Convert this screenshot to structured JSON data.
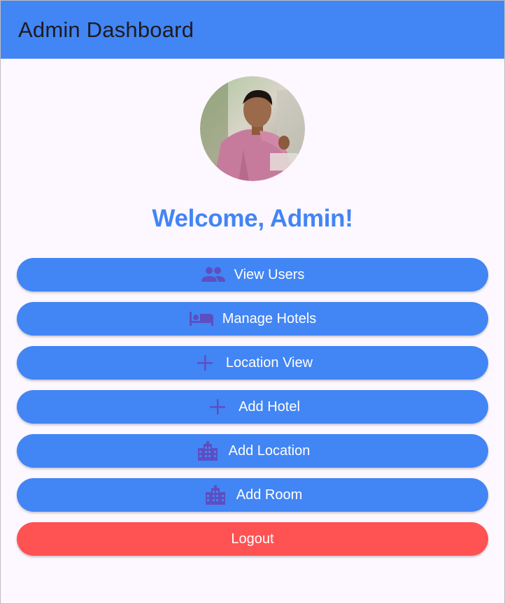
{
  "app_bar": {
    "title": "Admin Dashboard",
    "background": "#4285f4"
  },
  "profile": {
    "welcome_text": "Welcome, Admin!",
    "accent": "#4285f4"
  },
  "buttons": [
    {
      "label": "View Users",
      "icon": "people-icon",
      "color": "#4285f4"
    },
    {
      "label": "Manage Hotels",
      "icon": "bed-icon",
      "color": "#4285f4"
    },
    {
      "label": "Location View",
      "icon": "plus-icon",
      "color": "#4285f4"
    },
    {
      "label": "Add Hotel",
      "icon": "plus-icon",
      "color": "#4285f4"
    },
    {
      "label": "Add Location",
      "icon": "city-icon",
      "color": "#4285f4"
    },
    {
      "label": "Add Room",
      "icon": "city-icon",
      "color": "#4285f4"
    }
  ],
  "logout": {
    "label": "Logout",
    "color": "#ff5252"
  },
  "icon_color": "#5c4fc2"
}
